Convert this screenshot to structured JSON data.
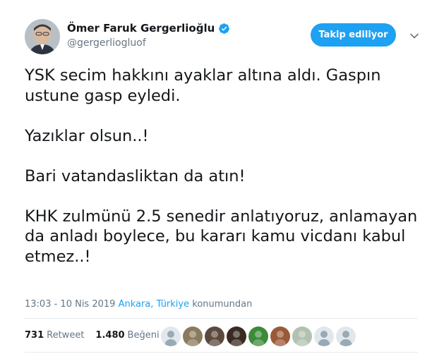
{
  "author": {
    "name": "Ömer Faruk Gergerlioğlu",
    "handle": "@gergerliogluof",
    "verified": true
  },
  "follow_button_label": "Takip ediliyor",
  "tweet": {
    "text": "YSK secim hakkını ayaklar altına aldı. Gaspın ustune gasp eyledi.\n\nYazıklar olsun..!\n\nBari vatandasliktan da atın!\n\nKHK zulmünü 2.5 senedir anlatıyoruz, anlamayan da anladı boylece, bu kararı kamu vicdanı kabul etmez..!",
    "time": "13:03 - 10 Nis 2019",
    "location": "Ankara, Türkiye",
    "location_suffix": "konumundan"
  },
  "stats": {
    "retweets": "731",
    "retweet_label": "Retweet",
    "likes": "1.480",
    "like_label": "Beğeni"
  },
  "likers": [
    {
      "icon": "default-avatar-icon",
      "color": "#99aab5"
    },
    {
      "icon": "sticker-avatar-icon",
      "color": "#8a7b5c"
    },
    {
      "icon": "portrait-avatar-icon",
      "color": "#5a4a3e"
    },
    {
      "icon": "glasses-avatar-icon",
      "color": "#3a2b22"
    },
    {
      "icon": "sports-badge-avatar-icon",
      "color": "#3c8a3a"
    },
    {
      "icon": "brown-avatar-icon",
      "color": "#9a5a3a"
    },
    {
      "icon": "illustration-avatar-icon",
      "color": "#b3c2b0"
    },
    {
      "icon": "default-avatar-icon",
      "color": "#99aab5"
    },
    {
      "icon": "default-avatar-icon",
      "color": "#99aab5"
    }
  ],
  "colors": {
    "accent": "#1da1f2",
    "secondary_text": "#657786",
    "primary_text": "#14171a"
  }
}
